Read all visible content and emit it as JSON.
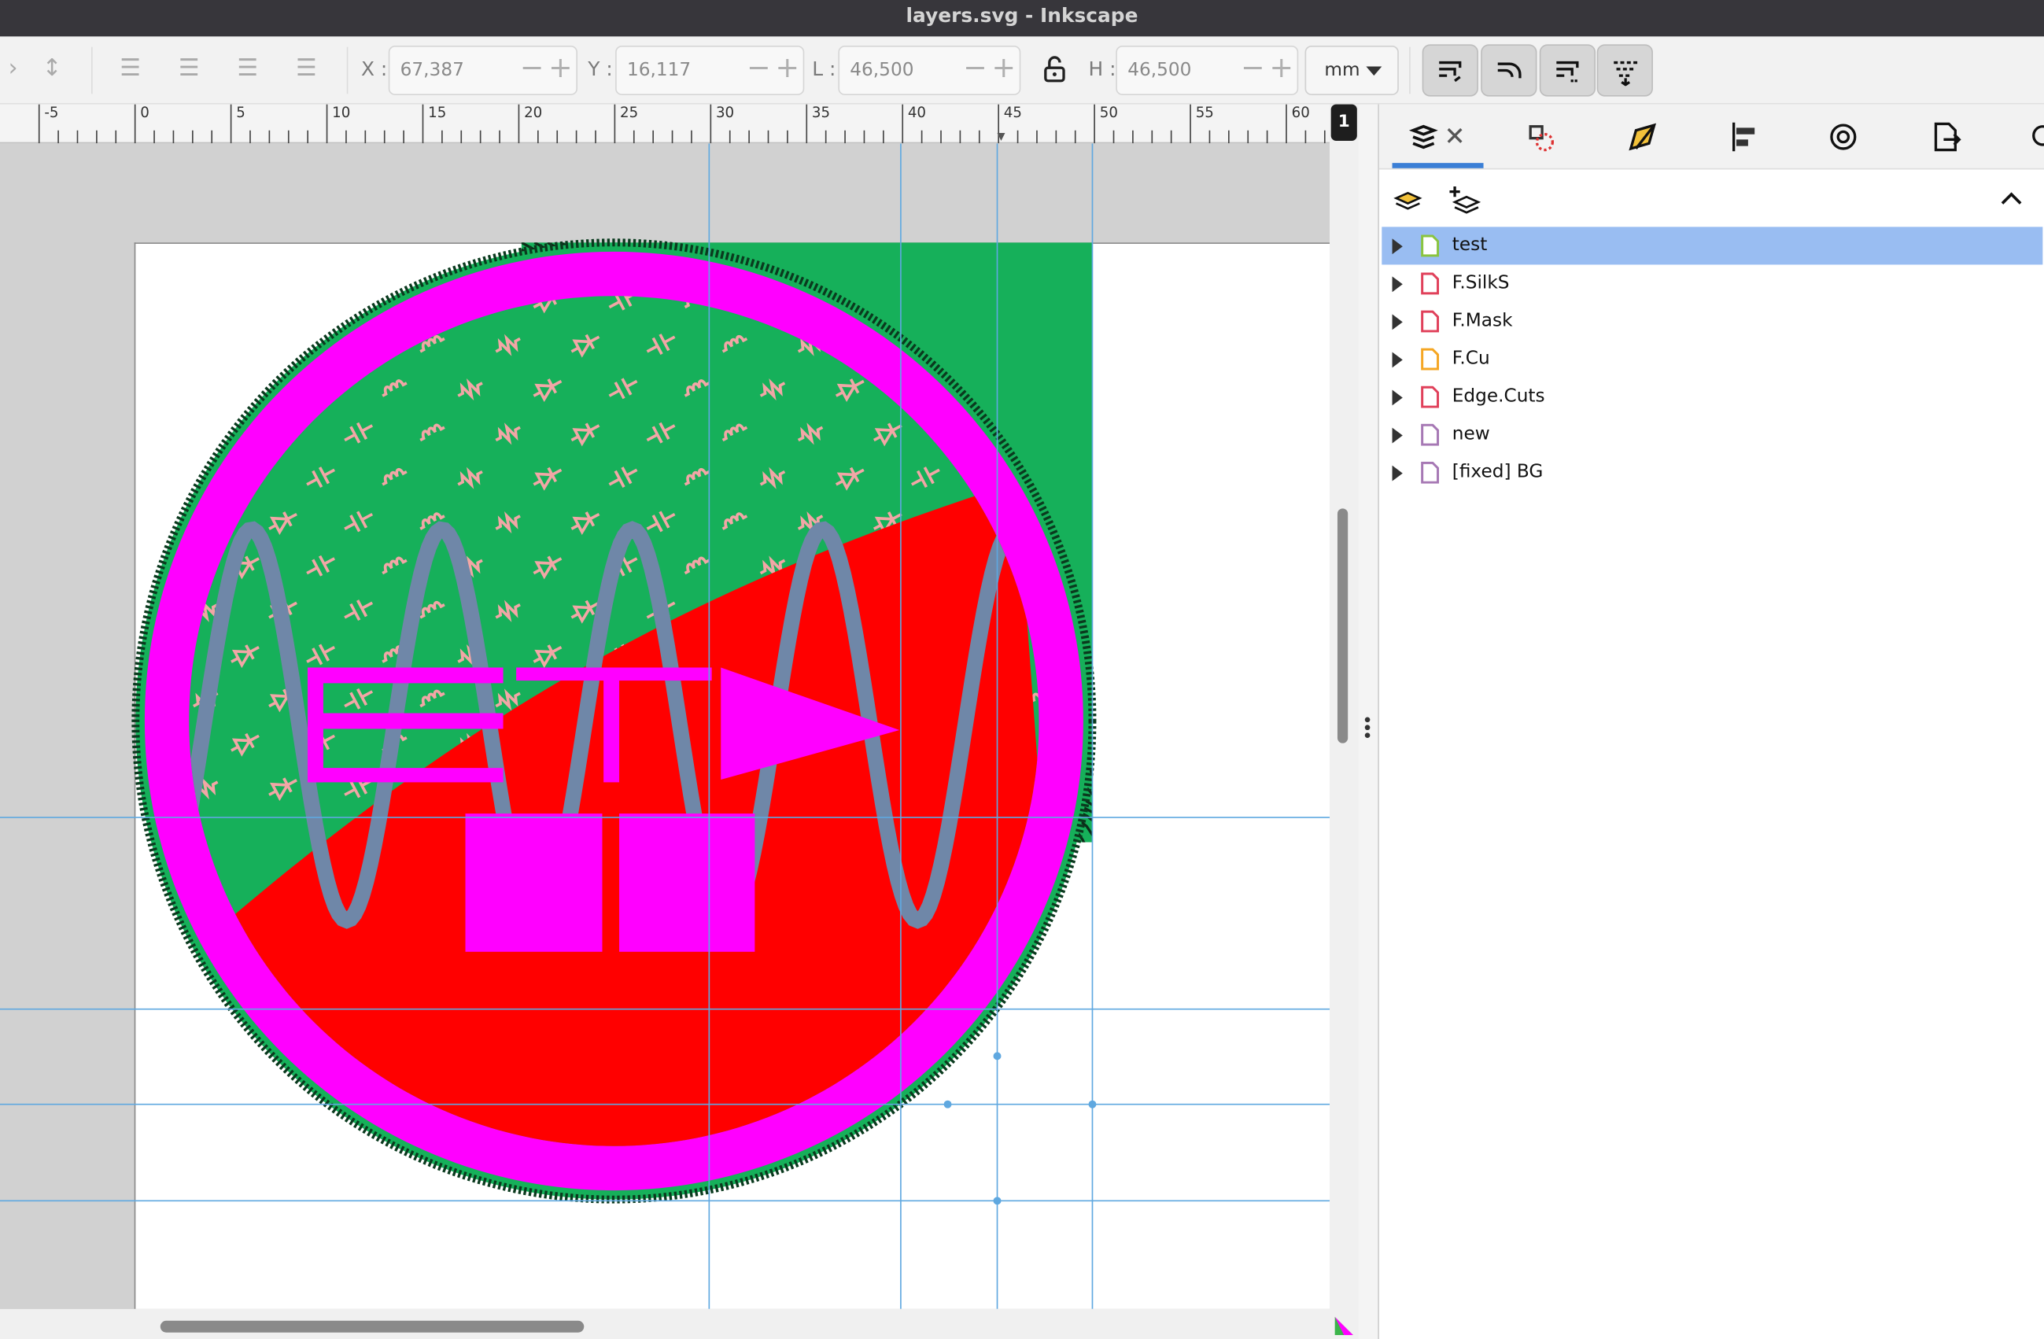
{
  "window": {
    "title": "layers.svg - Inkscape"
  },
  "toolbar": {
    "x_label": "X :",
    "x_value": "67,387",
    "y_label": "Y :",
    "y_value": "16,117",
    "w_label": "L :",
    "w_value": "46,500",
    "h_label": "H :",
    "h_value": "46,500",
    "unit": "mm",
    "minus": "−",
    "plus": "+"
  },
  "ruler": {
    "ticks": [
      "-5",
      "0",
      "5",
      "10",
      "15",
      "20",
      "25",
      "30",
      "35",
      "40",
      "45",
      "50",
      "55",
      "60"
    ],
    "page_badge": "1"
  },
  "layers_panel": {
    "layers": [
      {
        "name": "test",
        "color": "#8ac43f",
        "selected": true
      },
      {
        "name": "F.SilkS",
        "color": "#e0405a",
        "selected": false
      },
      {
        "name": "F.Mask",
        "color": "#e0405a",
        "selected": false
      },
      {
        "name": "F.Cu",
        "color": "#f5a623",
        "selected": false
      },
      {
        "name": "Edge.Cuts",
        "color": "#e0405a",
        "selected": false
      },
      {
        "name": "new",
        "color": "#a678b4",
        "selected": false
      },
      {
        "name": "[fixed] BG",
        "color": "#a678b4",
        "selected": false
      }
    ]
  },
  "colors": {
    "magenta": "#ff00ff",
    "red": "#ff0000",
    "green": "#16b05a",
    "wave": "#6f87a8",
    "guide": "#5fa8e0",
    "selection": "#99bdf2"
  }
}
